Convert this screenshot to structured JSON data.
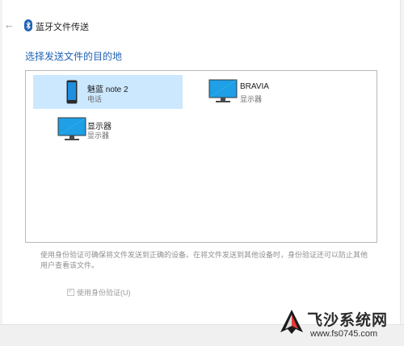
{
  "window": {
    "title": "蓝牙文件传送"
  },
  "heading": "选择发送文件的目的地",
  "devices": [
    {
      "name": "魅蓝 note 2",
      "type": "电话",
      "icon": "phone-icon",
      "selected": true
    },
    {
      "name": "BRAVIA",
      "type": "显示器",
      "icon": "monitor-icon",
      "selected": false
    },
    {
      "name": "显示器",
      "type": "显示器",
      "icon": "monitor-icon",
      "selected": false
    }
  ],
  "info_text": "使用身份验证可确保将文件发送到正确的设备。在将文件发送到其他设备时，身份验证还可以防止其他用户查看该文件。",
  "auth_checkbox": {
    "label": "使用身份验证(U)",
    "checked": true,
    "enabled": false
  },
  "watermark": {
    "title": "飞沙系统网",
    "url": "www.fs0745.com"
  },
  "colors": {
    "accent": "#1f62b4",
    "selection": "#cce8ff",
    "monitor_blue": "#1e9fe6"
  }
}
